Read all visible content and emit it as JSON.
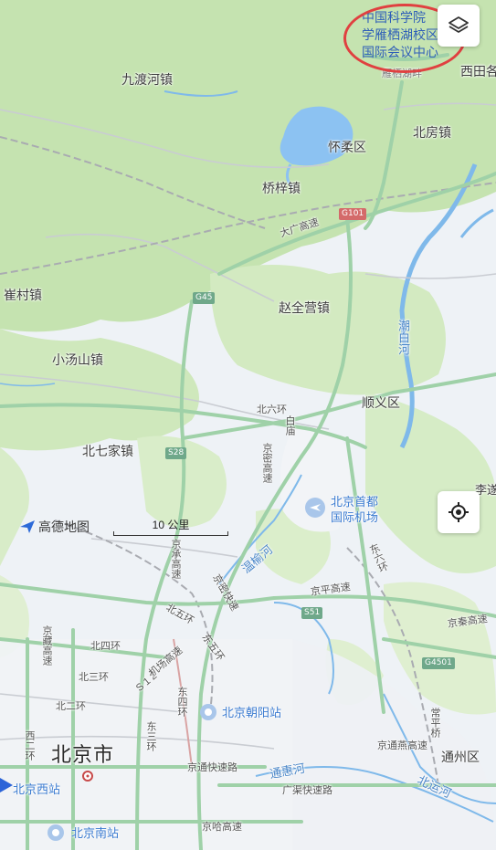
{
  "labels": {
    "jiudu": "九渡河镇",
    "huairou": "怀柔区",
    "beifang": "北房镇",
    "qiaozi": "桥梓镇",
    "xitian": "西田各",
    "cuncun": "崔村镇",
    "zhaoquanying": "赵全营镇",
    "xiaotangshan": "小汤山镇",
    "shunyi": "顺义区",
    "beiqijia": "北七家镇",
    "tongzhou": "通州区",
    "beijing": "北京市",
    "chaobai_river": "潮白河",
    "wenyu_river": "温榆河",
    "tonghui_river": "通惠河",
    "beiyun_river": "北运河",
    "xiqiao": "李遂",
    "yanqi": "雁栖湖畔"
  },
  "roads": {
    "daguang": "大广高速",
    "beiliuhuan": "北六环",
    "jingmi": "京密高速",
    "jingcheng": "京承高速",
    "jingping": "京平高速",
    "dongliuhuan": "东六环",
    "jingqin": "京秦高速",
    "beiwuhuan": "北五环",
    "jingzang": "京藏高速",
    "beisihuan": "北四环",
    "beisanhuan": "北三环",
    "beierhuan": "北二环",
    "jichang": "机场高速",
    "dongwuhuan": "东五环",
    "jingmiKuai": "京密快速",
    "dongsihuan": "东四环",
    "dongsanhuan": "东三环",
    "xierhuan": "西二环",
    "jingtong": "京通快速路",
    "guangqu": "广渠快速路",
    "jinghaa": "京哈高速",
    "jingtongKuai": "京通燕高速",
    "changping": "常平桥",
    "s12": "S 1 2",
    "yulin": "白庙"
  },
  "shields": {
    "g101": "G101",
    "g45": "G45",
    "s28": "S28",
    "s51": "S51",
    "g4501": "G4501"
  },
  "pois": {
    "airport": "北京首都\n国际机场",
    "chaoyang_station": "北京朝阳站",
    "west_station": "北京西站",
    "south_station": "北京南站"
  },
  "brand": "高德地图",
  "scale_label": "10 公里",
  "annotation": [
    "中国科学院",
    "学雁栖湖校区",
    "国际会议中心"
  ],
  "icons": {
    "layers": "layers-icon",
    "locate": "locate-icon"
  },
  "colors": {
    "green": "#c7e4b3",
    "urban": "#eef1f5",
    "water": "#8cc2f2",
    "highway": "#9fd1a8",
    "annotation_ring": "#e04040"
  }
}
